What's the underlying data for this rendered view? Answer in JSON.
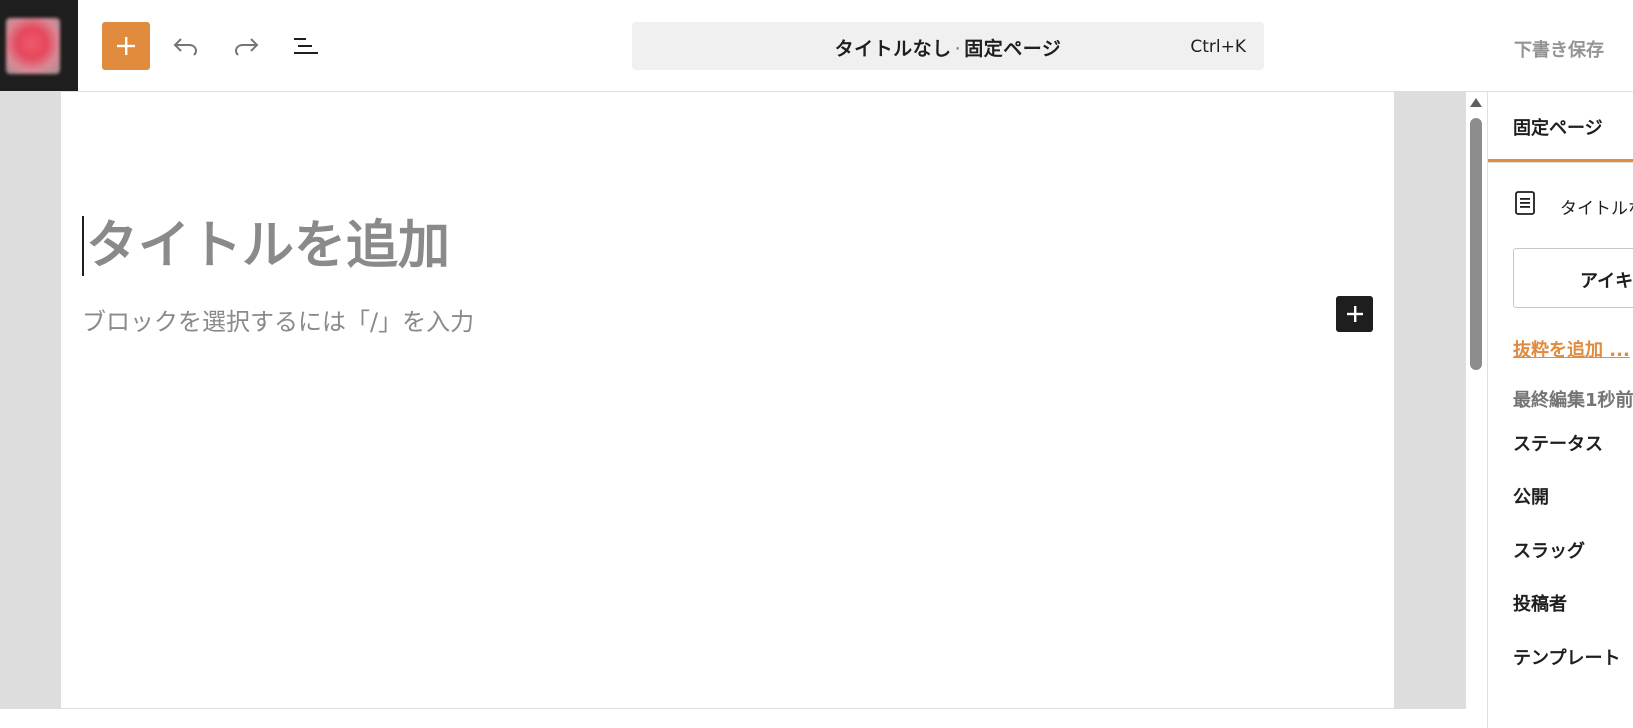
{
  "topbar": {
    "site_icon_name": "site-icon",
    "inserter_icon": "plus-icon",
    "undo_icon": "undo-icon",
    "redo_icon": "redo-icon",
    "document_overview_icon": "list-view-icon",
    "command": {
      "title": "タイトルなし",
      "separator": "·",
      "post_type": "固定ページ",
      "shortcut": "Ctrl+K"
    },
    "save_draft_label": "下書き保存"
  },
  "editor": {
    "title_placeholder": "タイトルを追加",
    "block_placeholder": "ブロックを選択するには「/」を入力",
    "block_inserter_icon": "plus-icon"
  },
  "sidebar": {
    "tab_label": "固定ページ",
    "document_icon": "page-icon",
    "document_title": "タイトルなし",
    "featured_image_label": "アイキャッチ画像を設定",
    "excerpt_link": "抜粋を追加 ...",
    "last_edited": "最終編集1秒前",
    "rows": {
      "status": "ステータス",
      "visibility": "公開",
      "slug": "スラッグ",
      "author": "投稿者",
      "template": "テンプレート"
    }
  },
  "colors": {
    "accent": "#e08b3e",
    "dark": "#1e1e1e",
    "placeholder": "#8a8a8a",
    "canvas_bg": "#dddddd"
  }
}
